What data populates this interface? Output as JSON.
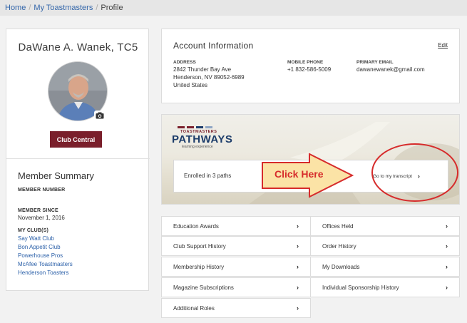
{
  "breadcrumb": {
    "home": "Home",
    "my_toastmasters": "My Toastmasters",
    "profile": "Profile"
  },
  "profile": {
    "name": "DaWane A. Wanek, TC5",
    "club_central_label": "Club Central"
  },
  "member_summary": {
    "title": "Member Summary",
    "member_number_label": "MEMBER NUMBER",
    "member_since_label": "MEMBER SINCE",
    "member_since_value": "November 1, 2016",
    "my_clubs_label": "MY CLUB(S)",
    "clubs": [
      "Say Watt Club",
      "Bon Appetit Club",
      "Powerhouse Pros",
      "McAfee Toastmasters",
      "Henderson Toasters"
    ]
  },
  "account": {
    "title": "Account Information",
    "edit_label": "Edit",
    "address_label": "ADDRESS",
    "address_line1": "2842 Thunder Bay Ave",
    "address_line2": "Henderson, NV 89052-6989",
    "address_line3": "United States",
    "mobile_label": "MOBILE PHONE",
    "mobile_value": "+1 832-586-5009",
    "email_label": "PRIMARY EMAIL",
    "email_value": "dawanewanek@gmail.com"
  },
  "pathways": {
    "logo_small": "TOASTMASTERS",
    "logo_main": "PATHWAYS",
    "logo_sub": "learning experience",
    "enrolled_text": "Enrolled in 3 paths",
    "transcript_label": "Go to my transcript",
    "annotation": "Click Here"
  },
  "links": {
    "education_awards": "Education Awards",
    "offices_held": "Offices Held",
    "club_support_history": "Club Support History",
    "order_history": "Order History",
    "membership_history": "Membership History",
    "my_downloads": "My Downloads",
    "magazine_subscriptions": "Magazine Subscriptions",
    "individual_sponsorship_history": "Individual Sponsorship History",
    "additional_roles": "Additional Roles"
  },
  "colors": {
    "brand_maroon": "#7a1f2b",
    "link_blue": "#2a5fa8",
    "annotation_red": "#d62b2b",
    "arrow_fill": "#fbe3a6"
  }
}
